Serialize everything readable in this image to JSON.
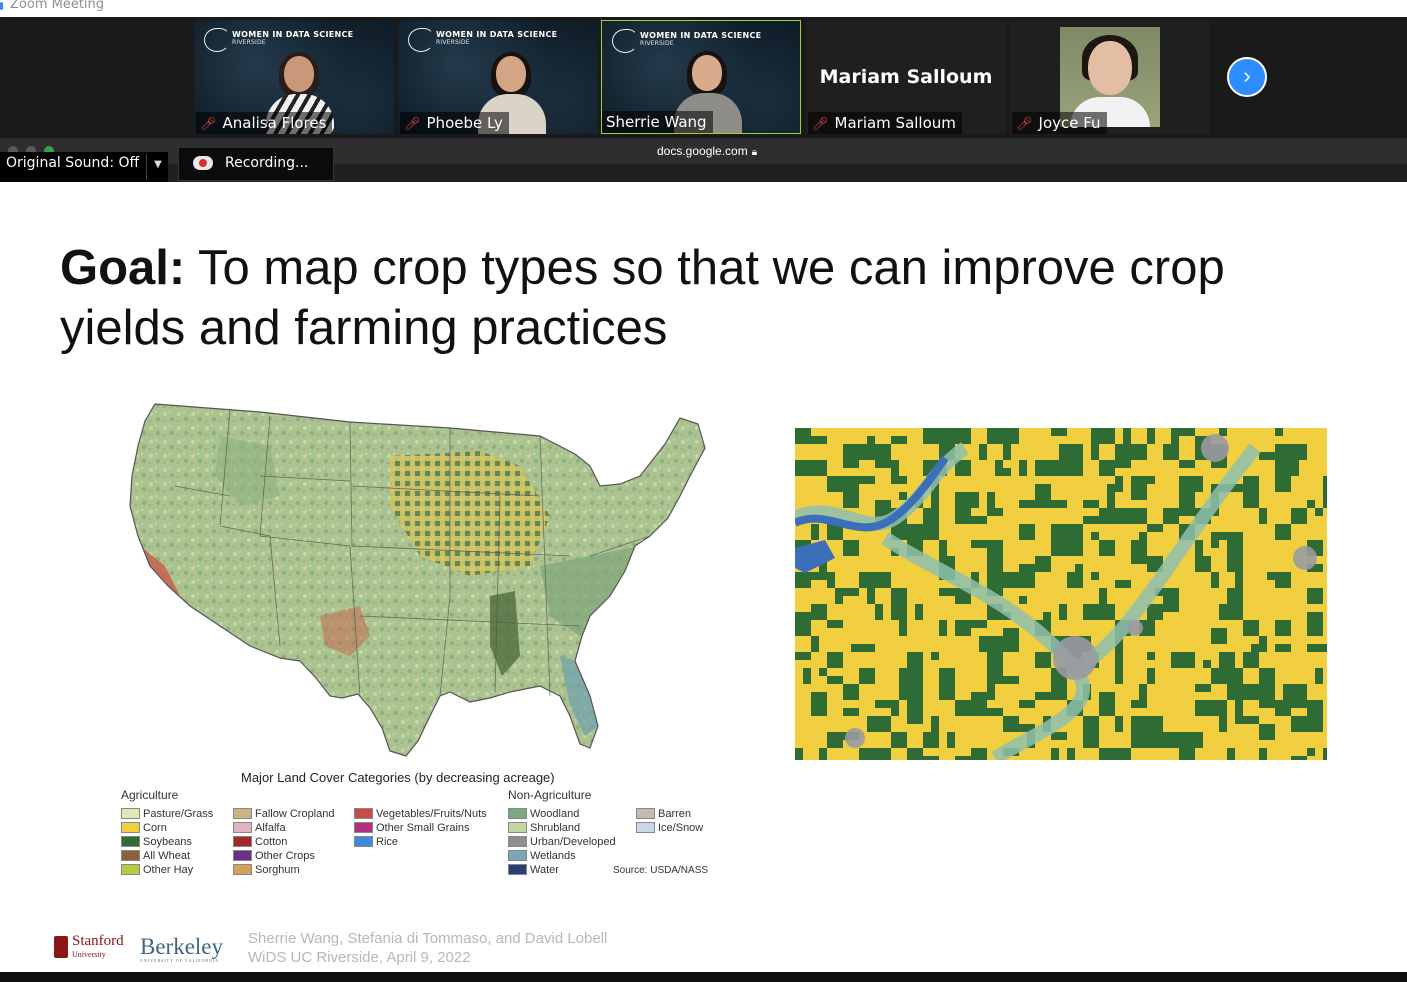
{
  "window": {
    "app_title": "Zoom Meeting"
  },
  "participants": [
    {
      "name": "Analisa Flores",
      "banner": "WOMEN IN DATA SCIENCE",
      "banner_sub": "RIVERSIDE",
      "muted": true
    },
    {
      "name": "Phoebe Ly",
      "banner": "WOMEN IN DATA SCIENCE",
      "banner_sub": "RIVERSIDE",
      "muted": true
    },
    {
      "name": "Sherrie Wang",
      "banner": "WOMEN IN DATA SCIENCE",
      "banner_sub": "RIVERSIDE",
      "muted": false,
      "active_speaker": true
    },
    {
      "name": "Mariam Salloum",
      "display_name": "Mariam Salloum",
      "muted": true,
      "video_off": true
    },
    {
      "name": "Joyce Fu",
      "muted": true,
      "profile_photo": true
    }
  ],
  "controls": {
    "next_page_icon": "chevron-right-icon",
    "original_sound": "Original Sound: Off",
    "recording": "Recording..."
  },
  "browser": {
    "url": "docs.google.com",
    "secure_icon": "lock-icon"
  },
  "slide": {
    "title_bold": "Goal:",
    "title_rest": " To map crop types so that we can improve crop yields and farming practices",
    "map_title": "Major Land Cover Categories (by decreasing acreage)",
    "legend": {
      "agriculture_label": "Agriculture",
      "non_agriculture_label": "Non-Agriculture",
      "agriculture": [
        [
          {
            "label": "Pasture/Grass",
            "color": "#dfe8b7"
          },
          {
            "label": "Corn",
            "color": "#f1cf3e"
          },
          {
            "label": "Soybeans",
            "color": "#2f6b34"
          },
          {
            "label": "All Wheat",
            "color": "#8a6238"
          },
          {
            "label": "Other Hay",
            "color": "#b5cc43"
          }
        ],
        [
          {
            "label": "Fallow Cropland",
            "color": "#cdb482"
          },
          {
            "label": "Alfalfa",
            "color": "#e3b2c2"
          },
          {
            "label": "Cotton",
            "color": "#a7262b"
          },
          {
            "label": "Other Crops",
            "color": "#6a2f88"
          },
          {
            "label": "Sorghum",
            "color": "#d2a25c"
          }
        ],
        [
          {
            "label": "Vegetables/Fruits/Nuts",
            "color": "#c64b4b"
          },
          {
            "label": "Other Small Grains",
            "color": "#b2307f"
          },
          {
            "label": "Rice",
            "color": "#3d8ad9"
          }
        ]
      ],
      "non_agriculture": [
        [
          {
            "label": "Woodland",
            "color": "#7aa97d"
          },
          {
            "label": "Shrubland",
            "color": "#c3d6a2"
          },
          {
            "label": "Urban/Developed",
            "color": "#8f8f8f"
          },
          {
            "label": "Wetlands",
            "color": "#7aa6b5"
          },
          {
            "label": "Water",
            "color": "#2c3f73"
          }
        ],
        [
          {
            "label": "Barren",
            "color": "#c9b8ae"
          },
          {
            "label": "Ice/Snow",
            "color": "#ccd6ea"
          }
        ]
      ]
    },
    "source": "Source: USDA/NASS",
    "logos": {
      "stanford": "Stanford",
      "stanford_sub": "University",
      "berkeley": "Berkeley",
      "berkeley_sub": "UNIVERSITY OF CALIFORNIA"
    },
    "credit_line1": "Sherrie Wang, Stefania di Tommaso, and David Lobell",
    "credit_line2": "WiDS UC Riverside, April 9, 2022"
  },
  "colors": {
    "zoom_blue": "#2d8cff",
    "mute_red": "#e8453c",
    "active_border": "#9ad03b",
    "corn": "#f1cf3e",
    "soy": "#2f6b34"
  }
}
